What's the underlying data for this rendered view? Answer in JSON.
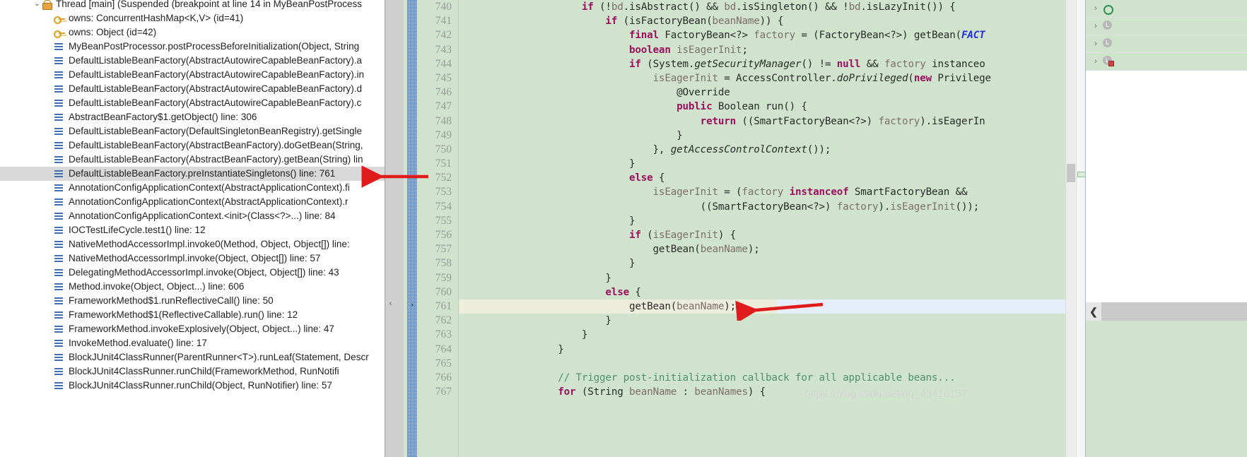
{
  "debug_stack": {
    "thread": {
      "icon": "thread-icon",
      "twisty": "chevron-down-icon",
      "label": "Thread [main] (Suspended (breakpoint at line 14 in MyBeanPostProcess"
    },
    "monitors": [
      {
        "icon": "key-icon",
        "label": "owns: ConcurrentHashMap<K,V>  (id=41)"
      },
      {
        "icon": "key-icon",
        "label": "owns: Object  (id=42)"
      }
    ],
    "frames": [
      {
        "label": "MyBeanPostProcessor.postProcessBeforeInitialization(Object, String",
        "selected": false
      },
      {
        "label": "DefaultListableBeanFactory(AbstractAutowireCapableBeanFactory).a",
        "selected": false
      },
      {
        "label": "DefaultListableBeanFactory(AbstractAutowireCapableBeanFactory).in",
        "selected": false
      },
      {
        "label": "DefaultListableBeanFactory(AbstractAutowireCapableBeanFactory).d",
        "selected": false
      },
      {
        "label": "DefaultListableBeanFactory(AbstractAutowireCapableBeanFactory).c",
        "selected": false
      },
      {
        "label": "AbstractBeanFactory$1.getObject() line: 306",
        "selected": false
      },
      {
        "label": "DefaultListableBeanFactory(DefaultSingletonBeanRegistry).getSingle",
        "selected": false
      },
      {
        "label": "DefaultListableBeanFactory(AbstractBeanFactory).doGetBean(String,",
        "selected": false
      },
      {
        "label": "DefaultListableBeanFactory(AbstractBeanFactory).getBean(String) lin",
        "selected": false
      },
      {
        "label": "DefaultListableBeanFactory.preInstantiateSingletons() line: 761",
        "selected": true
      },
      {
        "label": "AnnotationConfigApplicationContext(AbstractApplicationContext).fi",
        "selected": false
      },
      {
        "label": "AnnotationConfigApplicationContext(AbstractApplicationContext).r",
        "selected": false
      },
      {
        "label": "AnnotationConfigApplicationContext.<init>(Class<?>...) line: 84",
        "selected": false
      },
      {
        "label": "IOCTestLifeCycle.test1() line: 12",
        "selected": false
      },
      {
        "label": "NativeMethodAccessorImpl.invoke0(Method, Object, Object[]) line:",
        "selected": false
      },
      {
        "label": "NativeMethodAccessorImpl.invoke(Object, Object[]) line: 57",
        "selected": false
      },
      {
        "label": "DelegatingMethodAccessorImpl.invoke(Object, Object[]) line: 43",
        "selected": false
      },
      {
        "label": "Method.invoke(Object, Object...) line: 606",
        "selected": false
      },
      {
        "label": "FrameworkMethod$1.runReflectiveCall() line: 50",
        "selected": false
      },
      {
        "label": "FrameworkMethod$1(ReflectiveCallable).run() line: 12",
        "selected": false
      },
      {
        "label": "FrameworkMethod.invokeExplosively(Object, Object...) line: 47",
        "selected": false
      },
      {
        "label": "InvokeMethod.evaluate() line: 17",
        "selected": false
      },
      {
        "label": "BlockJUnit4ClassRunner(ParentRunner<T>).runLeaf(Statement, Descr",
        "selected": false
      },
      {
        "label": "BlockJUnit4ClassRunner.runChild(FrameworkMethod, RunNotifi",
        "selected": false
      },
      {
        "label": "BlockJUnit4ClassRunner.runChild(Object, RunNotifier) line: 57",
        "selected": false
      }
    ]
  },
  "editor": {
    "current_line": 761,
    "first_line": 740,
    "line_numbers": [
      740,
      741,
      742,
      743,
      744,
      745,
      746,
      747,
      748,
      749,
      750,
      751,
      752,
      753,
      754,
      755,
      756,
      757,
      758,
      759,
      760,
      761,
      762,
      763,
      764,
      765,
      766,
      767
    ],
    "lines": [
      {
        "n": 740,
        "text": "                    if (!bd.isAbstract() && bd.isSingleton() && !bd.isLazyInit()) {"
      },
      {
        "n": 741,
        "text": "                        if (isFactoryBean(beanName)) {"
      },
      {
        "n": 742,
        "text": "                            final FactoryBean<?> factory = (FactoryBean<?>) getBean(FACT"
      },
      {
        "n": 743,
        "text": "                            boolean isEagerInit;"
      },
      {
        "n": 744,
        "text": "                            if (System.getSecurityManager() != null && factory instanceo"
      },
      {
        "n": 745,
        "text": "                                isEagerInit = AccessController.doPrivileged(new Privilege"
      },
      {
        "n": 746,
        "text": "                                    @Override"
      },
      {
        "n": 747,
        "text": "                                    public Boolean run() {"
      },
      {
        "n": 748,
        "text": "                                        return ((SmartFactoryBean<?>) factory).isEagerIn"
      },
      {
        "n": 749,
        "text": "                                    }"
      },
      {
        "n": 750,
        "text": "                                }, getAccessControlContext());"
      },
      {
        "n": 751,
        "text": "                            }"
      },
      {
        "n": 752,
        "text": "                            else {"
      },
      {
        "n": 753,
        "text": "                                isEagerInit = (factory instanceof SmartFactoryBean &&"
      },
      {
        "n": 754,
        "text": "                                        ((SmartFactoryBean<?>) factory).isEagerInit());"
      },
      {
        "n": 755,
        "text": "                            }"
      },
      {
        "n": 756,
        "text": "                            if (isEagerInit) {"
      },
      {
        "n": 757,
        "text": "                                getBean(beanName);"
      },
      {
        "n": 758,
        "text": "                            }"
      },
      {
        "n": 759,
        "text": "                        }"
      },
      {
        "n": 760,
        "text": "                        else {"
      },
      {
        "n": 761,
        "text": "                            getBean(beanName);"
      },
      {
        "n": 762,
        "text": "                        }"
      },
      {
        "n": 763,
        "text": "                    }"
      },
      {
        "n": 764,
        "text": "                }"
      },
      {
        "n": 765,
        "text": ""
      },
      {
        "n": 766,
        "text": "                // Trigger post-initialization callback for all applicable beans..."
      },
      {
        "n": 767,
        "text": "                for (String beanName : beanNames) {"
      }
    ]
  },
  "variables_panel": {
    "rows": [
      {
        "chevron": "chevron-right-icon",
        "icon": "object-icon",
        "label": ""
      },
      {
        "chevron": "chevron-right-icon",
        "icon": "local-var-icon",
        "label": ""
      },
      {
        "chevron": "chevron-right-icon",
        "icon": "local-var-icon",
        "label": ""
      },
      {
        "chevron": "chevron-right-icon",
        "icon": "local-var-modified-icon",
        "label": ""
      }
    ],
    "collapse_icon": "chevron-left-icon"
  },
  "annotations": {
    "arrow_stack_color": "#e01b1b",
    "arrow_code_color": "#e01b1b",
    "watermark": "https://blog.csdn.net/qq_43416157"
  },
  "colors": {
    "editor_background": "#cfe3cd",
    "current_line_background": "#eceedb",
    "selection_background": "#e6eefb",
    "keyword": "#9c0f5f",
    "comment": "#4f8f6a",
    "constant": "#2630d6",
    "selected_row_background": "#d9d9d9",
    "stack_frame_icon": "#3f6fb5"
  }
}
